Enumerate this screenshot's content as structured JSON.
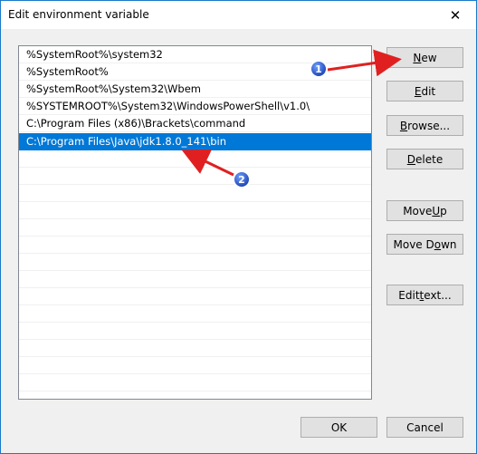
{
  "window": {
    "title": "Edit environment variable"
  },
  "list": {
    "items": [
      "%SystemRoot%\\system32",
      "%SystemRoot%",
      "%SystemRoot%\\System32\\Wbem",
      "%SYSTEMROOT%\\System32\\WindowsPowerShell\\v1.0\\",
      "C:\\Program Files (x86)\\Brackets\\command",
      "C:\\Program Files\\Java\\jdk1.8.0_141\\bin"
    ],
    "selected_index": 5
  },
  "buttons": {
    "new": {
      "pre": "",
      "u": "N",
      "post": "ew"
    },
    "edit": {
      "pre": "",
      "u": "E",
      "post": "dit"
    },
    "browse": {
      "pre": "",
      "u": "B",
      "post": "rowse..."
    },
    "delete": {
      "pre": "",
      "u": "D",
      "post": "elete"
    },
    "move_up": {
      "pre": "Move ",
      "u": "U",
      "post": "p"
    },
    "move_down": {
      "pre": "Move D",
      "u": "o",
      "post": "wn"
    },
    "edit_text": {
      "pre": "Edit ",
      "u": "t",
      "post": "ext..."
    },
    "ok": "OK",
    "cancel": "Cancel"
  },
  "annotations": [
    {
      "label": "1"
    },
    {
      "label": "2"
    }
  ],
  "colors": {
    "selection": "#0078d7",
    "window_border": "#1979ca",
    "annotation_arrow": "#e02020",
    "annotation_badge": "#1a3fb0"
  }
}
